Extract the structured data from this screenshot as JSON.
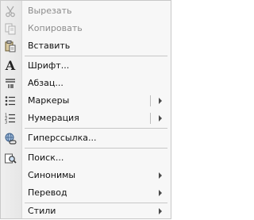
{
  "menu": {
    "cut": "Вырезать",
    "copy": "Копировать",
    "paste": "Вставить",
    "font": "Шрифт...",
    "paragraph": "Абзац...",
    "bullets": "Маркеры",
    "numbering": "Нумерация",
    "hyperlink": "Гиперссылка...",
    "search": "Поиск...",
    "synonyms": "Синонимы",
    "translate": "Перевод",
    "styles": "Стили"
  }
}
